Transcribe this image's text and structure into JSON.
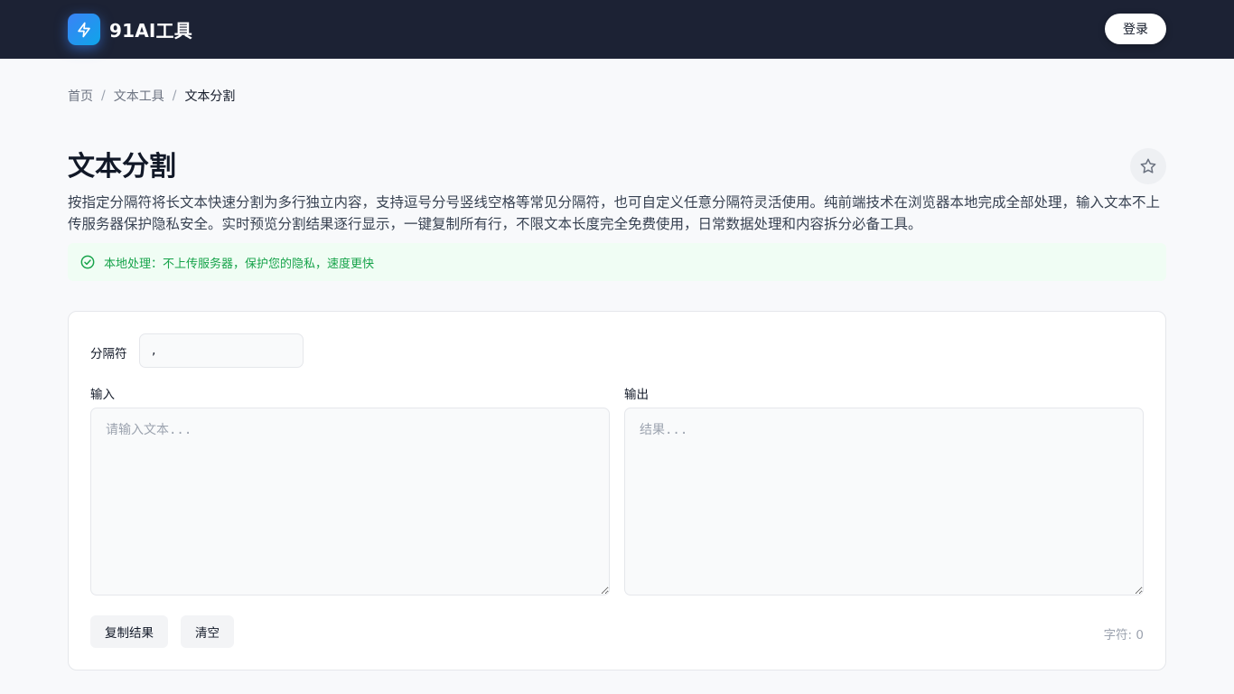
{
  "header": {
    "logo_text": "91AI工具",
    "login_label": "登录"
  },
  "breadcrumb": {
    "items": [
      "首页",
      "文本工具",
      "文本分割"
    ],
    "separator": "/"
  },
  "page": {
    "title": "文本分割",
    "description": "按指定分隔符将长文本快速分割为多行独立内容，支持逗号分号竖线空格等常见分隔符，也可自定义任意分隔符灵活使用。纯前端技术在浏览器本地完成全部处理，输入文本不上传服务器保护隐私安全。实时预览分割结果逐行显示，一键复制所有行，不限文本长度完全免费使用，日常数据处理和内容拆分必备工具。",
    "notice": "本地处理：不上传服务器，保护您的隐私，速度更快"
  },
  "tool": {
    "separator_label": "分隔符",
    "separator_value": ",",
    "input_label": "输入",
    "input_placeholder": "请输入文本...",
    "input_value": "",
    "output_label": "输出",
    "output_placeholder": "结果...",
    "output_value": "",
    "copy_label": "复制结果",
    "clear_label": "清空",
    "char_count": "字符: 0"
  },
  "colors": {
    "header_bg": "#1c2234",
    "accent": "#3b82f6",
    "notice_text": "#16a34a",
    "notice_bg": "#f0fdf4"
  },
  "icons": {
    "logo": "lightning-icon",
    "favorite": "star-icon",
    "notice": "check-circle-icon"
  }
}
